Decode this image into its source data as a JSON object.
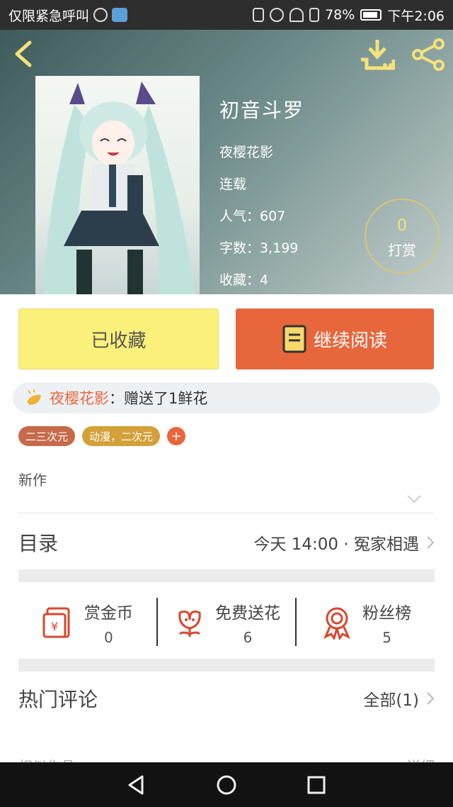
{
  "status_bar": {
    "left_text": "仅限紧急呼叫",
    "battery": "78%",
    "time": "下午2:06"
  },
  "hero": {
    "title": "初音斗罗",
    "author": "夜樱花影",
    "status": "连载",
    "popularity": "人气：607",
    "word_count": "字数：3,199",
    "favorites": "收藏：4",
    "tip_count": "0",
    "tip_label": "打赏"
  },
  "actions": {
    "favorited_label": "已收藏",
    "continue_label": "继续阅读"
  },
  "gift": {
    "user": "夜樱花影",
    "message": "：赠送了1鲜花"
  },
  "tags": [
    "二三次元",
    "动漫，二次元"
  ],
  "tag_add": "+",
  "description": "新作",
  "toc": {
    "title": "目录",
    "latest": "今天 14:00 · 冤家相遇"
  },
  "stats": [
    {
      "label": "赏金币",
      "value": "0",
      "icon": "red-envelope-icon"
    },
    {
      "label": "免费送花",
      "value": "6",
      "icon": "flower-icon"
    },
    {
      "label": "粉丝榜",
      "value": "5",
      "icon": "medal-icon"
    }
  ],
  "comments": {
    "title": "热门评论",
    "all": "全部(1)"
  },
  "similar": {
    "title": "相似作品",
    "more": "详细"
  },
  "colors": {
    "accent": "#e8663c",
    "favorite_bg": "#fbf07a",
    "icon_red": "#d8482f",
    "hero_icon_yellow": "#f5e27a"
  }
}
